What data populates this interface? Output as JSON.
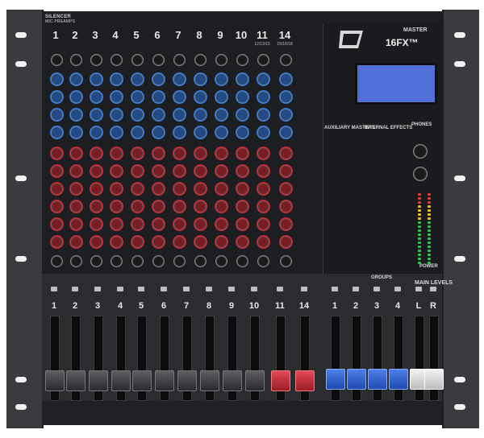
{
  "brand": {
    "line1": "SILENCER",
    "line2": "MIC PREAMPS"
  },
  "top_channels": [
    {
      "num": "1",
      "sub": ""
    },
    {
      "num": "2",
      "sub": ""
    },
    {
      "num": "3",
      "sub": ""
    },
    {
      "num": "4",
      "sub": ""
    },
    {
      "num": "5",
      "sub": ""
    },
    {
      "num": "6",
      "sub": ""
    },
    {
      "num": "7",
      "sub": ""
    },
    {
      "num": "8",
      "sub": ""
    },
    {
      "num": "9",
      "sub": ""
    },
    {
      "num": "10",
      "sub": ""
    },
    {
      "num": "11",
      "sub": "12/13/15"
    },
    {
      "num": "14",
      "sub": "15/16/18"
    }
  ],
  "master": {
    "header": "MASTER",
    "model": "16FX™",
    "logo_text": "Peavey",
    "aux_masters": "AUXILIARY MASTERS",
    "internal_effects": "INTERNAL EFFECTS",
    "phones": "PHONES",
    "groups": "GROUPS",
    "main_levels": "MAIN LEVELS",
    "left": "L",
    "right": "R",
    "power": "POWER"
  },
  "fader_channels": [
    "1",
    "2",
    "3",
    "4",
    "5",
    "6",
    "7",
    "8",
    "9",
    "10",
    "11",
    "14"
  ],
  "group_faders": [
    "1",
    "2",
    "3",
    "4"
  ],
  "colors": {
    "blue_knob": "#3a7bd5",
    "red_knob": "#c0303a",
    "lcd": "#4f6fd6"
  }
}
